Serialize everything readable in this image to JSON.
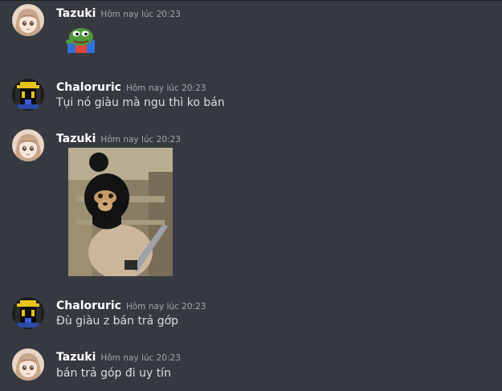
{
  "messages": [
    {
      "author": "Tazuki",
      "timestamp": "Hôm nay lúc 20:23",
      "attachment": "pepe-emoji",
      "avatar_icon": "anime-girl-avatar"
    },
    {
      "author": "Chaloruric",
      "timestamp": "Hôm nay lúc 20:23",
      "text": "Tụi nó giàu mà ngu thì ko bán",
      "avatar_icon": "pixel-mask-avatar"
    },
    {
      "author": "Tazuki",
      "timestamp": "Hôm nay lúc 20:23",
      "attachment": "masked-dog-gif",
      "avatar_icon": "anime-girl-avatar"
    },
    {
      "author": "Chaloruric",
      "timestamp": "Hôm nay lúc 20:23",
      "text": "Đù giàu z bán trả gớp",
      "avatar_icon": "pixel-mask-avatar"
    },
    {
      "author": "Tazuki",
      "timestamp": "Hôm nay lúc 20:23",
      "text": "bán trả góp đi uy tín",
      "avatar_icon": "anime-girl-avatar"
    }
  ],
  "colors": {
    "background": "#36393f",
    "author": "#ffffff",
    "timestamp": "#a3a6aa",
    "text": "#dcddde"
  }
}
